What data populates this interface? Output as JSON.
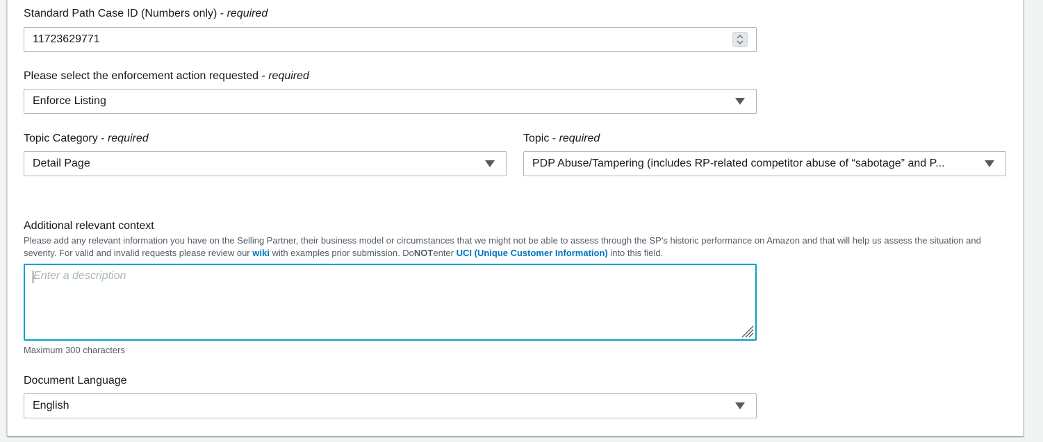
{
  "form": {
    "case_id": {
      "label": "Standard Path Case ID (Numbers only)",
      "required_text": "required",
      "value": "11723629771"
    },
    "enforcement_action": {
      "label": "Please select the enforcement action requested",
      "required_text": "required",
      "selected": "Enforce Listing"
    },
    "topic_category": {
      "label": "Topic Category",
      "required_text": "required",
      "selected": "Detail Page"
    },
    "topic": {
      "label": "Topic",
      "required_text": "required",
      "selected": "PDP Abuse/Tampering (includes RP-related competitor abuse of “sabotage” and P..."
    },
    "additional_context": {
      "label": "Additional relevant context",
      "description_part1": "Please add any relevant information you have on the Selling Partner, their business model or circumstances that we might not be able to assess through the SP’s historic performance on Amazon and that will help us assess the situation and severity. For valid and invalid requests please review our ",
      "wiki_link": "wiki",
      "description_part2": " with examples prior submission. Do",
      "not_text": "NOT",
      "description_part3": "enter ",
      "uci_link": "UCI (Unique Customer Information)",
      "description_part4": " into this field.",
      "placeholder": "Enter a description",
      "value": "",
      "constraint": "Maximum 300 characters"
    },
    "document_language": {
      "label": "Document Language",
      "selected": "English"
    },
    "separator": " - "
  },
  "icons": {
    "select_caret": "caret-down-icon",
    "number_stepper": "stepper-icon",
    "resize_grip": "resize-grip-icon"
  },
  "colors": {
    "focus_border": "#00a1c9",
    "link": "#0073bb",
    "border": "#aab7b8",
    "text": "#16191f",
    "secondary_text": "#545b64"
  }
}
